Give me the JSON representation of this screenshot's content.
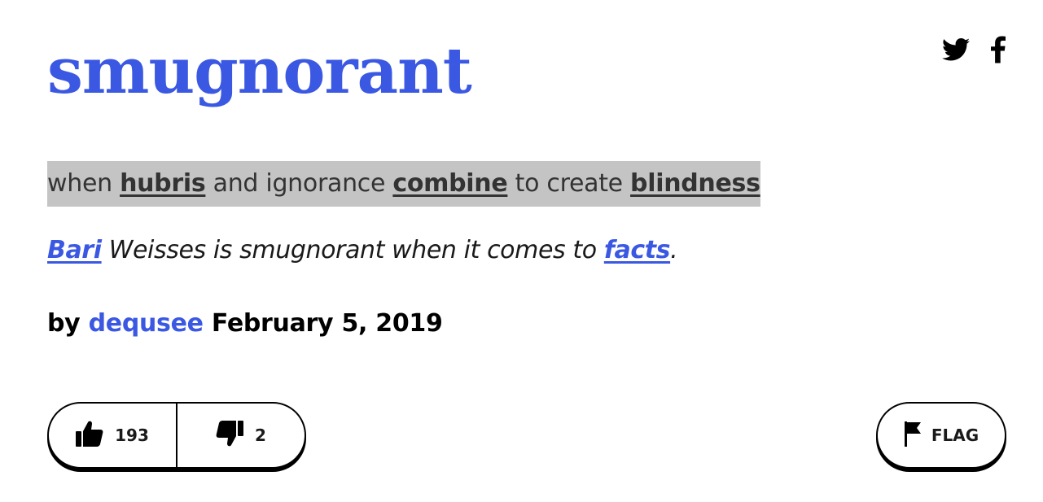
{
  "definition": {
    "word": "smugnorant",
    "meaning": {
      "t1": "when ",
      "l1": "hubris",
      "t2": " and ignorance ",
      "l2": "combine",
      "t3": " to create ",
      "l3": "blindness"
    },
    "example": {
      "l1": "Bari",
      "t1": " Weisses is smugnorant when it comes to ",
      "l2": "facts",
      "t2": "."
    },
    "contributor": {
      "by": "by",
      "author": "dequsee",
      "date": "February 5, 2019"
    }
  },
  "share": {
    "icons": [
      "twitter-icon",
      "facebook-icon"
    ]
  },
  "votes": {
    "up_count": "193",
    "down_count": "2",
    "icons": [
      "thumbs-up-icon",
      "thumbs-down-icon"
    ]
  },
  "flag": {
    "label": "FLAG",
    "icon": "flag-icon"
  },
  "colors": {
    "accent": "#3b58e3",
    "highlight": "#c4c4c4",
    "text": "#1a1a1a"
  }
}
